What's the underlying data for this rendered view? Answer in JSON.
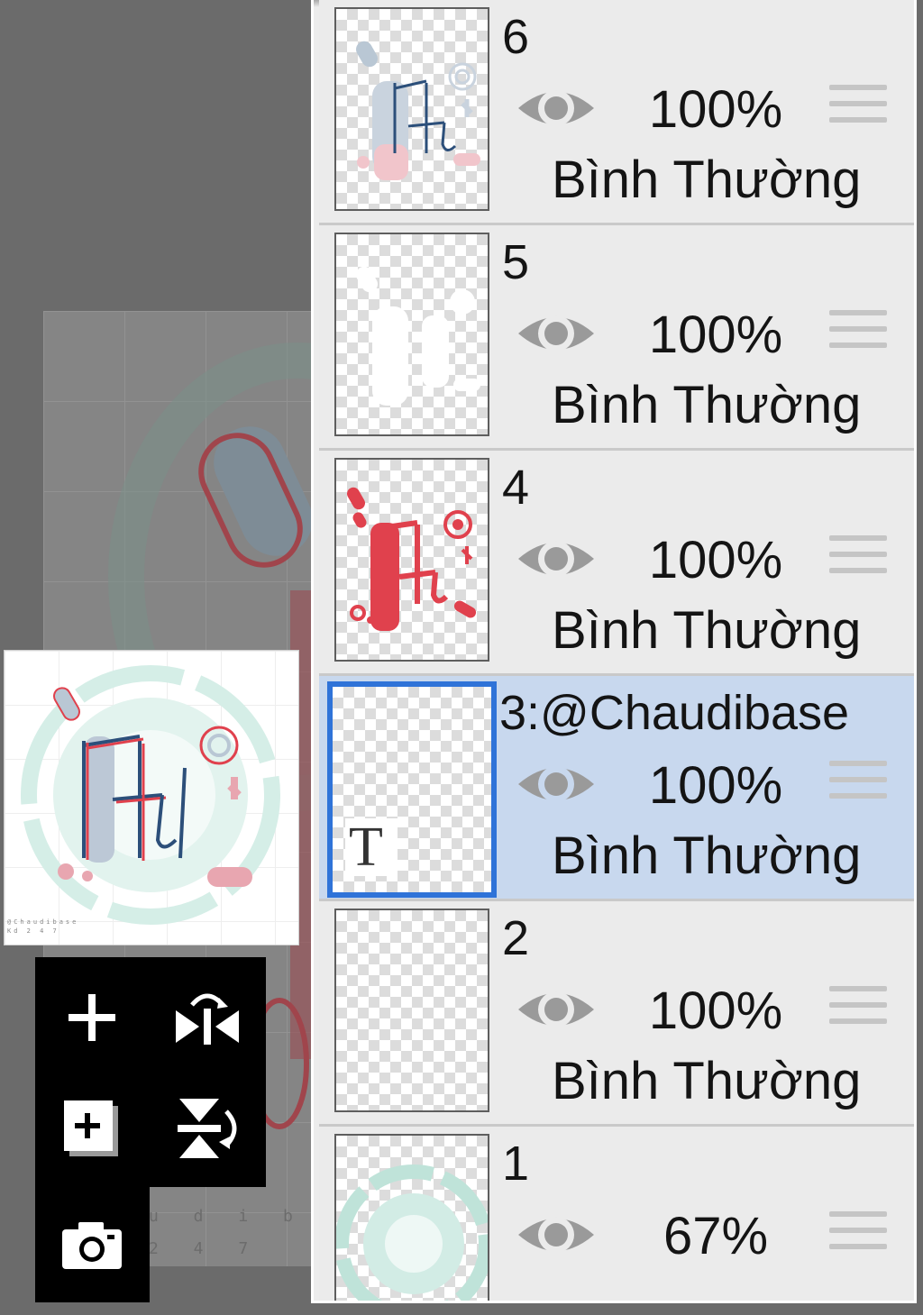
{
  "canvas": {
    "watermark_line1": "u d i b a s",
    "watermark_line2": "2 4 7"
  },
  "preview": {
    "credit_line1": "@Chaudibase",
    "credit_line2": "Kd 2 4 7"
  },
  "toolbar": {
    "add_layer_icon": "plus-icon",
    "flip_horizontal_icon": "flip-horizontal-icon",
    "duplicate_layer_icon": "duplicate-layer-icon",
    "flip_vertical_icon": "flip-vertical-icon",
    "import_photo_icon": "camera-icon"
  },
  "layers": [
    {
      "name": "6",
      "opacity": "100%",
      "blend": "Bình Thường",
      "selected": false
    },
    {
      "name": "5",
      "opacity": "100%",
      "blend": "Bình Thường",
      "selected": false
    },
    {
      "name": "4",
      "opacity": "100%",
      "blend": "Bình Thường",
      "selected": false
    },
    {
      "name": "3:@Chaudibase",
      "opacity": "100%",
      "blend": "Bình Thường",
      "selected": true,
      "type_badge": "T"
    },
    {
      "name": "2",
      "opacity": "100%",
      "blend": "Bình Thường",
      "selected": false
    },
    {
      "name": "1",
      "opacity": "67%",
      "blend": "Bình Thường",
      "selected": false
    }
  ],
  "colors": {
    "selected_row": "#c8d8ee",
    "selected_border": "#2f73d8",
    "accent_red": "#e0414d",
    "accent_blue": "#2c4f7a",
    "accent_mint": "#bfe3d9"
  }
}
